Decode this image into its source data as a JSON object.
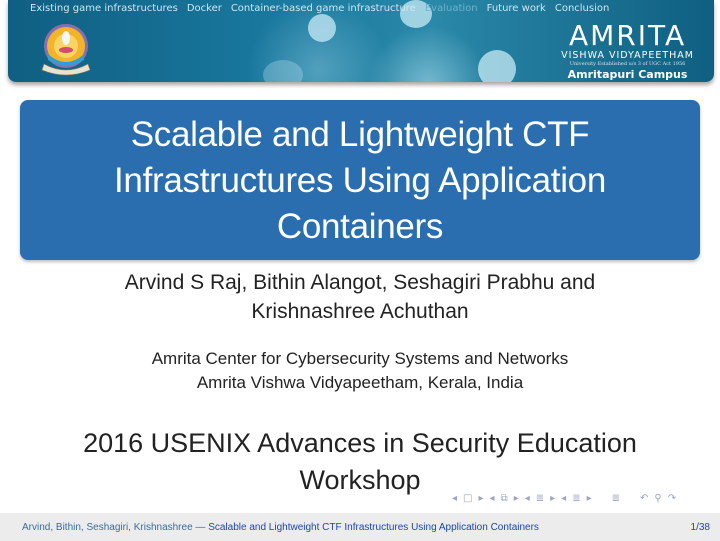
{
  "header": {
    "nav_items": [
      {
        "label": "Existing game infrastructures",
        "active": false
      },
      {
        "label": "Docker",
        "active": false
      },
      {
        "label": "Container-based game infrastructure",
        "active": false
      },
      {
        "label": "Evaluation",
        "active": false
      },
      {
        "label": "Future work",
        "active": false
      },
      {
        "label": "Conclusion",
        "active": false
      }
    ],
    "brand": {
      "name": "AMRITA",
      "subtitle": "VISHWA VIDYAPEETHAM",
      "tagline": "University Established u/s 3 of UGC Act 1956",
      "campus": "Amritapuri Campus"
    }
  },
  "slide": {
    "title": "Scalable and Lightweight CTF Infrastructures Using Application Containers",
    "title_lines": [
      "Scalable and Lightweight CTF",
      "Infrastructures Using Application",
      "Containers"
    ],
    "authors_lines": [
      "Arvind S Raj, Bithin Alangot, Seshagiri Prabhu and",
      "Krishnashree Achuthan"
    ],
    "institute_lines": [
      "Amrita Center for Cybersecurity Systems and Networks",
      "Amrita Vishwa Vidyapeetham, Kerala, India"
    ],
    "venue_lines": [
      "2016 USENIX Advances in Security Education",
      "Workshop"
    ]
  },
  "beamer_nav": {
    "frame_prev": "◂",
    "frame_icon": "□",
    "frame_next": "▸",
    "subsec_prev": "◂",
    "subsec_icon": "⧉",
    "subsec_next": "▸",
    "sec_prev": "◂",
    "sec_icon": "≣",
    "sec_next": "▸",
    "part_prev": "◂",
    "part_icon": "≣",
    "part_next": "▸",
    "doc_icon": "≣",
    "back_icon": "↶",
    "search_icon": "⚲",
    "forward_icon": "↷"
  },
  "footer": {
    "authors": "Arvind, Bithin, Seshagiri, Krishnashree — ",
    "title": "Scalable and Lightweight CTF Infrastructures Using Application Containers",
    "page": "1/38"
  }
}
